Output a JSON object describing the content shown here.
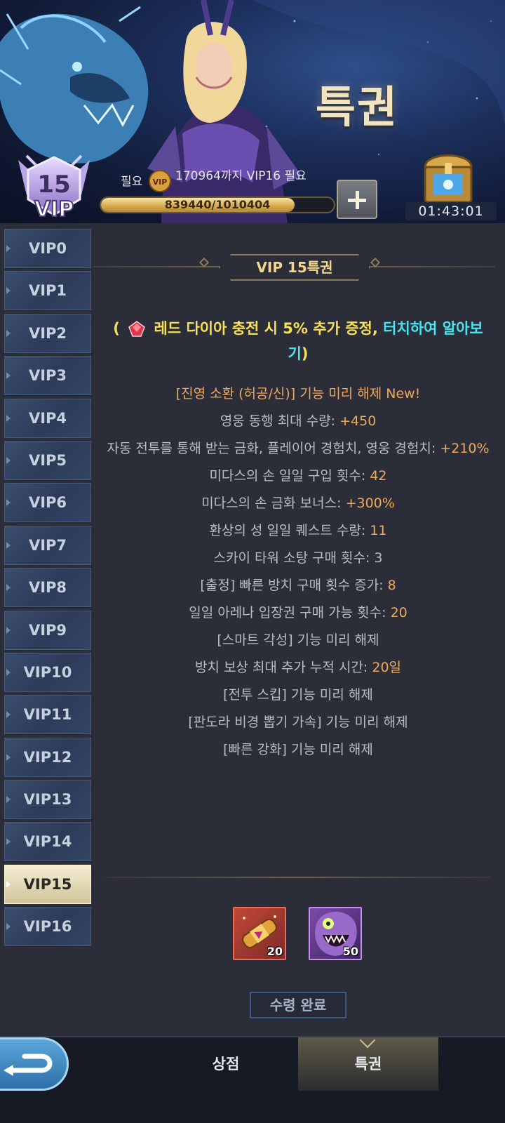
{
  "banner": {
    "title": "특권",
    "vip_level": "15",
    "vip_label": "VIP",
    "required_label": "필요",
    "coin_label": "VIP",
    "required_text": "170964까지 VIP16 필요",
    "exp_text": "839440/1010404",
    "exp_progress": 0.8308,
    "timer": "01:43:01"
  },
  "sidebar": {
    "tabs": [
      "VIP0",
      "VIP1",
      "VIP2",
      "VIP3",
      "VIP4",
      "VIP5",
      "VIP6",
      "VIP7",
      "VIP8",
      "VIP9",
      "VIP10",
      "VIP11",
      "VIP12",
      "VIP13",
      "VIP14",
      "VIP15",
      "VIP16"
    ],
    "active": "VIP15"
  },
  "main": {
    "header": "VIP 15특권",
    "promo": {
      "open_paren": "(",
      "text": "레드 다이아 충전 시 5% 추가 증정,",
      "link": "터치하여 알아보기",
      "close_paren": ")"
    },
    "benefits": [
      {
        "label": "[진영 소환 (허공/신)] 기능 미리 해제  New!",
        "value": "",
        "highlight": true
      },
      {
        "label": "영웅 동행 최대 수량: ",
        "value": "+450"
      },
      {
        "label": "자동 전투를 통해 받는 금화, 플레이어 경험치, 영웅 경험치: ",
        "value": "+210%"
      },
      {
        "label": "미다스의 손 일일 구입 횟수: ",
        "value": "42"
      },
      {
        "label": "미다스의 손 금화 보너스: ",
        "value": "+300%"
      },
      {
        "label": "환상의 성 일일 퀘스트 수량: ",
        "value": "11"
      },
      {
        "label": "스카이 타워 소탕 구매 횟수: 3",
        "value": ""
      },
      {
        "label": "[출정] 빠른 방치 구매 횟수 증가: ",
        "value": "8"
      },
      {
        "label": "일일 아레나 입장권 구매 가능 횟수: ",
        "value": "20"
      },
      {
        "label": "[스마트 각성] 기능 미리 해제",
        "value": ""
      },
      {
        "label": "방치 보상 최대 추가 누적 시간: ",
        "value": "20일"
      },
      {
        "label": "[전투 스킵] 기능 미리 해제",
        "value": ""
      },
      {
        "label": "[판도라 비경 뽑기 가속] 기능 미리 해제",
        "value": ""
      },
      {
        "label": "[빠른 강화] 기능 미리 해제",
        "value": ""
      }
    ],
    "rewards": [
      {
        "icon": "scroll-icon",
        "qty": "20"
      },
      {
        "icon": "monster-icon",
        "qty": "50"
      }
    ],
    "claim_label": "수령 완료"
  },
  "nav": {
    "shop_label": "상점",
    "privilege_label": "특권"
  }
}
